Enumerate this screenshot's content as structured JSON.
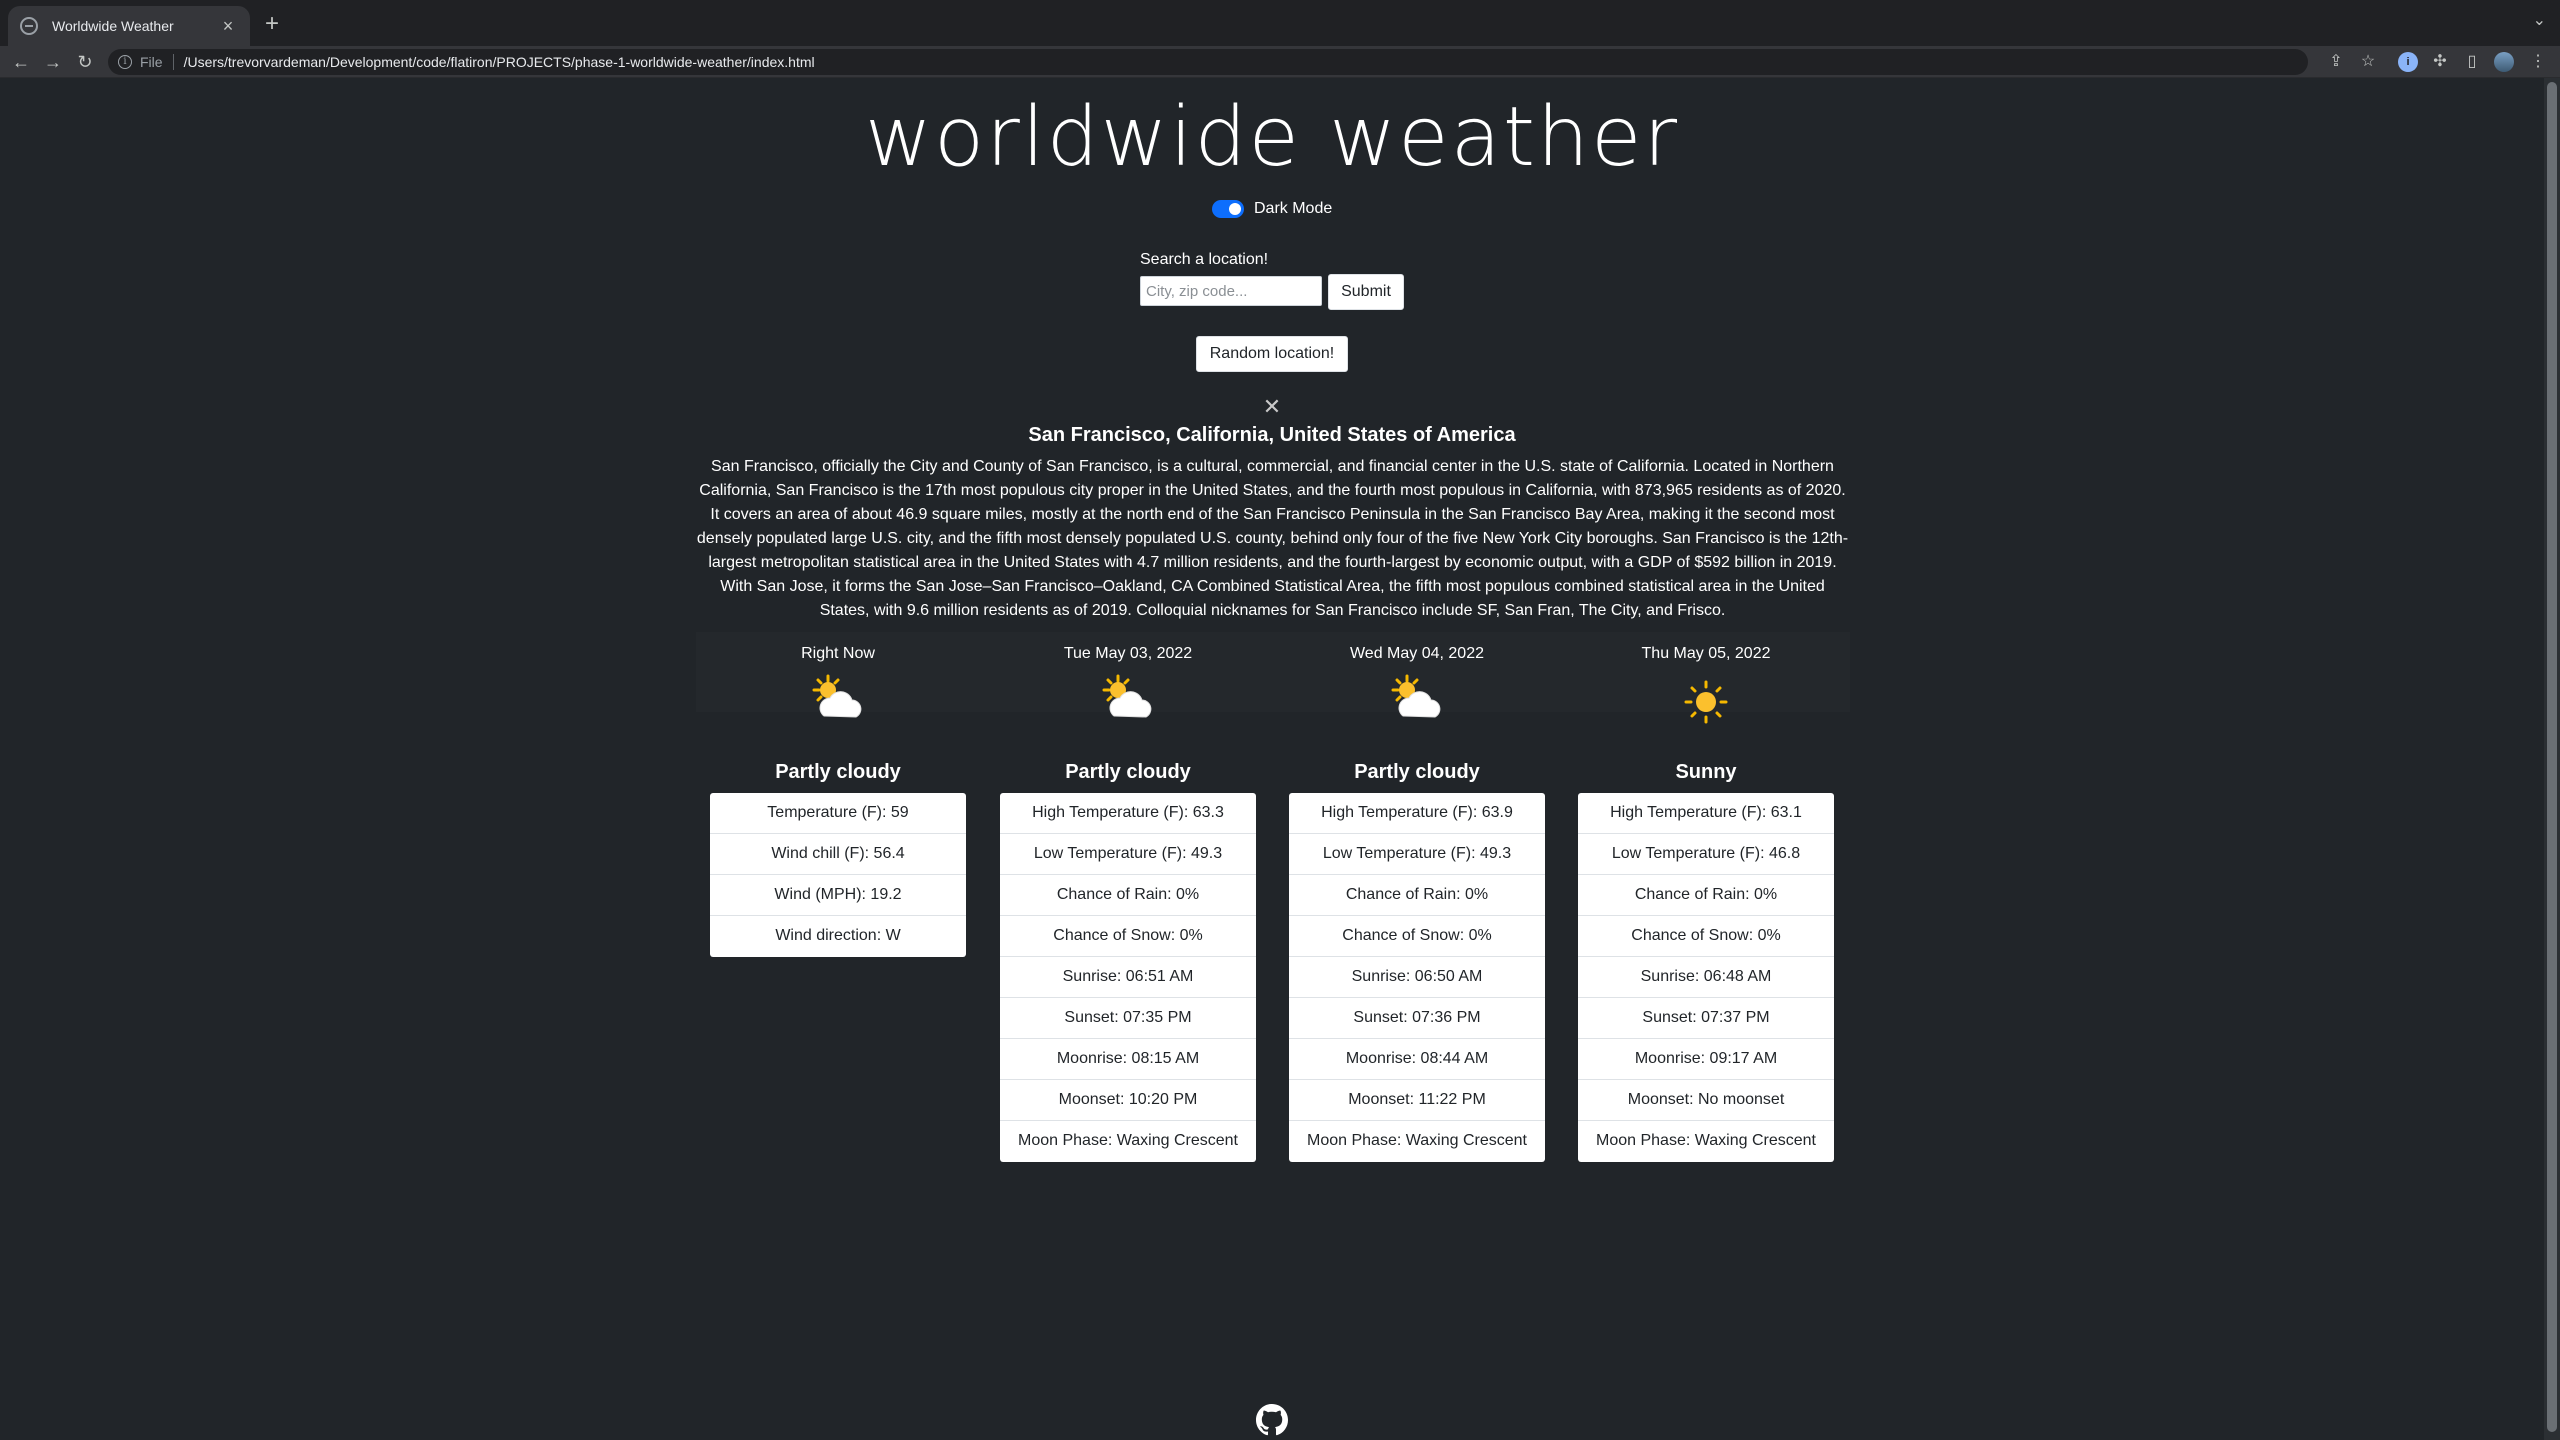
{
  "browser": {
    "tab_title": "Worldwide Weather",
    "file_label": "File",
    "url": "/Users/trevorvardeman/Development/code/flatiron/PROJECTS/phase-1-worldwide-weather/index.html"
  },
  "header": {
    "title": "worldwide weather",
    "dark_mode_label": "Dark Mode",
    "dark_mode_on": true
  },
  "search": {
    "label": "Search a location!",
    "placeholder": "City, zip code...",
    "submit_label": "Submit",
    "random_label": "Random location!"
  },
  "location": {
    "name": "San Francisco, California, United States of America",
    "description": "San Francisco, officially the City and County of San Francisco, is a cultural, commercial, and financial center in the U.S. state of California. Located in Northern California, San Francisco is the 17th most populous city proper in the United States, and the fourth most populous in California, with 873,965 residents as of 2020. It covers an area of about 46.9 square miles, mostly at the north end of the San Francisco Peninsula in the San Francisco Bay Area, making it the second most densely populated large U.S. city, and the fifth most densely populated U.S. county, behind only four of the five New York City boroughs. San Francisco is the 12th-largest metropolitan statistical area in the United States with 4.7 million residents, and the fourth-largest by economic output, with a GDP of $592 billion in 2019. With San Jose, it forms the San Jose–San Francisco–Oakland, CA Combined Statistical Area, the fifth most populous combined statistical area in the United States, with 9.6 million residents as of 2019. Colloquial nicknames for San Francisco include SF, San Fran, The City, and Frisco."
  },
  "forecast": [
    {
      "heading": "Right Now",
      "icon": "partly-cloudy-icon",
      "condition": "Partly cloudy",
      "items": [
        "Temperature (F): 59",
        "Wind chill (F): 56.4",
        "Wind (MPH): 19.2",
        "Wind direction: W"
      ]
    },
    {
      "heading": "Tue May 03, 2022",
      "icon": "partly-cloudy-icon",
      "condition": "Partly cloudy",
      "items": [
        "High Temperature (F): 63.3",
        "Low Temperature (F): 49.3",
        "Chance of Rain: 0%",
        "Chance of Snow: 0%",
        "Sunrise: 06:51 AM",
        "Sunset: 07:35 PM",
        "Moonrise: 08:15 AM",
        "Moonset: 10:20 PM",
        "Moon Phase: Waxing Crescent"
      ]
    },
    {
      "heading": "Wed May 04, 2022",
      "icon": "partly-cloudy-icon",
      "condition": "Partly cloudy",
      "items": [
        "High Temperature (F): 63.9",
        "Low Temperature (F): 49.3",
        "Chance of Rain: 0%",
        "Chance of Snow: 0%",
        "Sunrise: 06:50 AM",
        "Sunset: 07:36 PM",
        "Moonrise: 08:44 AM",
        "Moonset: 11:22 PM",
        "Moon Phase: Waxing Crescent"
      ]
    },
    {
      "heading": "Thu May 05, 2022",
      "icon": "sunny-icon",
      "condition": "Sunny",
      "items": [
        "High Temperature (F): 63.1",
        "Low Temperature (F): 46.8",
        "Chance of Rain: 0%",
        "Chance of Snow: 0%",
        "Sunrise: 06:48 AM",
        "Sunset: 07:37 PM",
        "Moonrise: 09:17 AM",
        "Moonset: No moonset",
        "Moon Phase: Waxing Crescent"
      ]
    }
  ],
  "colors": {
    "background": "#212529",
    "accent": "#0d6efd",
    "card": "#ffffff"
  }
}
